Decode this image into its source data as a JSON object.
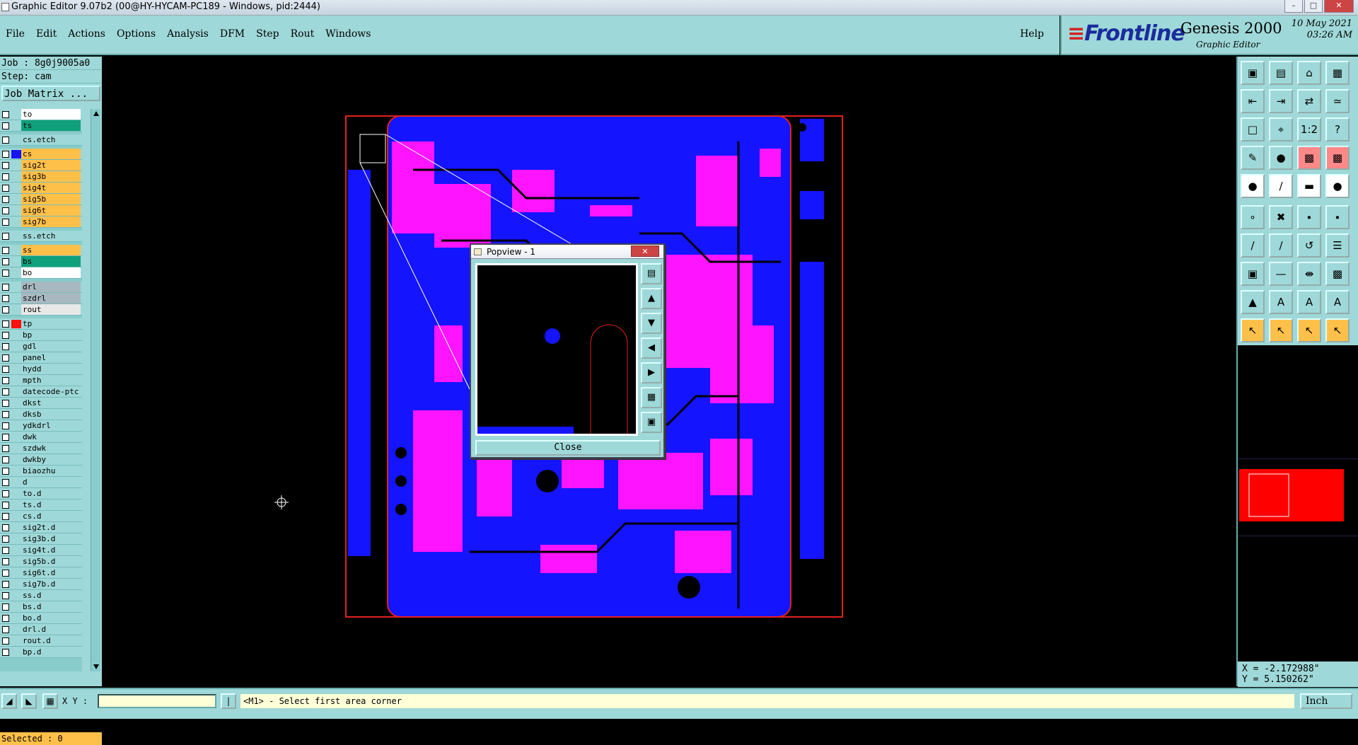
{
  "window": {
    "title": "Graphic Editor 9.07b2 (00@HY-HYCAM-PC189 - Windows, pid:2444)"
  },
  "menu": {
    "items": [
      "File",
      "Edit",
      "Actions",
      "Options",
      "Analysis",
      "DFM",
      "Step",
      "Rout",
      "Windows"
    ],
    "help": "Help"
  },
  "brand": {
    "logo": "Frontline",
    "product": "Genesis 2000",
    "subtitle": "Graphic Editor",
    "date": "10 May 2021",
    "time": "03:26 AM"
  },
  "job": {
    "job": "Job : 8g0j9005a0",
    "step": "Step: cam",
    "matrix_button": "Job Matrix ..."
  },
  "layers": [
    {
      "name": "to",
      "bg": "#ffffff",
      "swatch": "",
      "gap": false
    },
    {
      "name": "ts",
      "bg": "#10a07c",
      "swatch": "",
      "gap": false
    },
    {
      "name": "cs.etch",
      "bg": "#9fd8d8",
      "swatch": "",
      "gap": true
    },
    {
      "name": "cs",
      "bg": "#ffc04a",
      "swatch": "#1414ff",
      "gap": true
    },
    {
      "name": "sig2t",
      "bg": "#ffc04a",
      "swatch": "",
      "gap": false
    },
    {
      "name": "sig3b",
      "bg": "#ffc04a",
      "swatch": "",
      "gap": false
    },
    {
      "name": "sig4t",
      "bg": "#ffc04a",
      "swatch": "",
      "gap": false
    },
    {
      "name": "sig5b",
      "bg": "#ffc04a",
      "swatch": "",
      "gap": false
    },
    {
      "name": "sig6t",
      "bg": "#ffc04a",
      "swatch": "",
      "gap": false
    },
    {
      "name": "sig7b",
      "bg": "#ffc04a",
      "swatch": "",
      "gap": false
    },
    {
      "name": "ss.etch",
      "bg": "#9fd8d8",
      "swatch": "",
      "gap": true
    },
    {
      "name": "ss",
      "bg": "#ffc04a",
      "swatch": "",
      "gap": true
    },
    {
      "name": "bs",
      "bg": "#10a07c",
      "swatch": "",
      "gap": false
    },
    {
      "name": "bo",
      "bg": "#ffffff",
      "swatch": "",
      "gap": false
    },
    {
      "name": "drl",
      "bg": "#a8b8c0",
      "swatch": "",
      "gap": true
    },
    {
      "name": "szdrl",
      "bg": "#a8b8c0",
      "swatch": "",
      "gap": false
    },
    {
      "name": "rout",
      "bg": "#e8e8e8",
      "swatch": "",
      "gap": false
    },
    {
      "name": "tp",
      "bg": "#9fd8d8",
      "swatch": "#ff1010",
      "gap": true
    },
    {
      "name": "bp",
      "bg": "#9fd8d8",
      "swatch": "",
      "gap": false
    },
    {
      "name": "gdl",
      "bg": "#9fd8d8",
      "swatch": "",
      "gap": false
    },
    {
      "name": "panel",
      "bg": "#9fd8d8",
      "swatch": "",
      "gap": false
    },
    {
      "name": "hydd",
      "bg": "#9fd8d8",
      "swatch": "",
      "gap": false
    },
    {
      "name": "mpth",
      "bg": "#9fd8d8",
      "swatch": "",
      "gap": false
    },
    {
      "name": "datecode-ptc",
      "bg": "#9fd8d8",
      "swatch": "",
      "gap": false
    },
    {
      "name": "dkst",
      "bg": "#9fd8d8",
      "swatch": "",
      "gap": false
    },
    {
      "name": "dksb",
      "bg": "#9fd8d8",
      "swatch": "",
      "gap": false
    },
    {
      "name": "ydkdrl",
      "bg": "#9fd8d8",
      "swatch": "",
      "gap": false
    },
    {
      "name": "dwk",
      "bg": "#9fd8d8",
      "swatch": "",
      "gap": false
    },
    {
      "name": "szdwk",
      "bg": "#9fd8d8",
      "swatch": "",
      "gap": false
    },
    {
      "name": "dwkby",
      "bg": "#9fd8d8",
      "swatch": "",
      "gap": false
    },
    {
      "name": "biaozhu",
      "bg": "#9fd8d8",
      "swatch": "",
      "gap": false
    },
    {
      "name": "d",
      "bg": "#9fd8d8",
      "swatch": "",
      "gap": false
    },
    {
      "name": "to.d",
      "bg": "#9fd8d8",
      "swatch": "",
      "gap": false
    },
    {
      "name": "ts.d",
      "bg": "#9fd8d8",
      "swatch": "",
      "gap": false
    },
    {
      "name": "cs.d",
      "bg": "#9fd8d8",
      "swatch": "",
      "gap": false
    },
    {
      "name": "sig2t.d",
      "bg": "#9fd8d8",
      "swatch": "",
      "gap": false
    },
    {
      "name": "sig3b.d",
      "bg": "#9fd8d8",
      "swatch": "",
      "gap": false
    },
    {
      "name": "sig4t.d",
      "bg": "#9fd8d8",
      "swatch": "",
      "gap": false
    },
    {
      "name": "sig5b.d",
      "bg": "#9fd8d8",
      "swatch": "",
      "gap": false
    },
    {
      "name": "sig6t.d",
      "bg": "#9fd8d8",
      "swatch": "",
      "gap": false
    },
    {
      "name": "sig7b.d",
      "bg": "#9fd8d8",
      "swatch": "",
      "gap": false
    },
    {
      "name": "ss.d",
      "bg": "#9fd8d8",
      "swatch": "",
      "gap": false
    },
    {
      "name": "bs.d",
      "bg": "#9fd8d8",
      "swatch": "",
      "gap": false
    },
    {
      "name": "bo.d",
      "bg": "#9fd8d8",
      "swatch": "",
      "gap": false
    },
    {
      "name": "drl.d",
      "bg": "#9fd8d8",
      "swatch": "",
      "gap": false
    },
    {
      "name": "rout.d",
      "bg": "#9fd8d8",
      "swatch": "",
      "gap": false
    },
    {
      "name": "bp.d",
      "bg": "#9fd8d8",
      "swatch": "",
      "gap": false
    }
  ],
  "selected": "Selected : 0",
  "popview": {
    "title": "Popview - 1",
    "close": "Close"
  },
  "coords": {
    "x": "X = -2.172988\"",
    "y": "Y = 5.150262\""
  },
  "statusbar": {
    "xy_label": "X Y :",
    "message": "<M1> - Select first area corner",
    "unit": "Inch"
  },
  "colors": {
    "panel": "#9fd8d8",
    "board": "#1414ff",
    "pads": "#ff14ff",
    "outline": "#e02020",
    "active_layer": "#ffc04a"
  }
}
